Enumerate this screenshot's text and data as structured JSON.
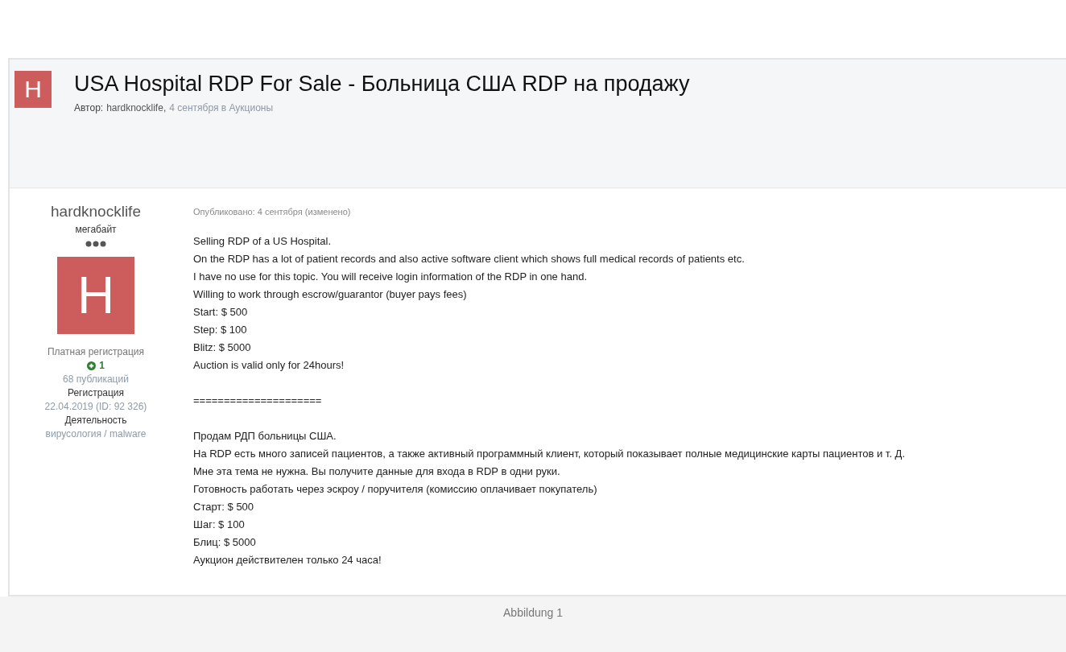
{
  "topic": {
    "avatar_letter": "H",
    "title": "USA Hospital RDP For Sale - Больница США RDP на продажу",
    "byline": {
      "label": "Автор:",
      "author": "hardknocklife,",
      "date_forum": "4 сентября в Аукционы"
    }
  },
  "author": {
    "name": "hardknocklife",
    "rank": "мегабайт",
    "avatar_letter": "H",
    "group": "Платная регистрация",
    "reputation": "1",
    "posts": "68 публикаций",
    "fields": [
      {
        "label": "Регистрация",
        "value": "22.04.2019 (ID: 92 326)"
      },
      {
        "label": "Деятельность",
        "value": "вирусология / malware"
      }
    ]
  },
  "post": {
    "meta": "Опубликовано: 4 сентября (изменено)",
    "blocks": [
      [
        "Selling RDP of a US Hospital.",
        "On the RDP has a lot of patient records and also active software client which shows full medical records of patients etc.",
        "I have no use for this topic. You will receive login information of the RDP in one hand.",
        "Willing to work through escrow/guarantor (buyer pays fees)",
        "Start: $ 500",
        "Step: $ 100",
        "Blitz: $ 5000",
        "Auction is valid only for 24hours!"
      ],
      [
        "====================="
      ],
      [
        "Продам РДП больницы США.",
        "На RDP есть много записей пациентов, а также активный программный клиент, который показывает полные медицинские карты пациентов и т. Д.",
        "Мне эта тема не нужна. Вы получите данные для входа в RDP в одни руки.",
        "Готовность работать через эскроу / поручителя (комиссию оплачивает покупатель)",
        "Старт: $ 500",
        "Шаг: $ 100",
        "Блиц: $ 5000",
        "Аукцион действителен только 24 часа!"
      ]
    ]
  },
  "caption": "Abbildung 1"
}
